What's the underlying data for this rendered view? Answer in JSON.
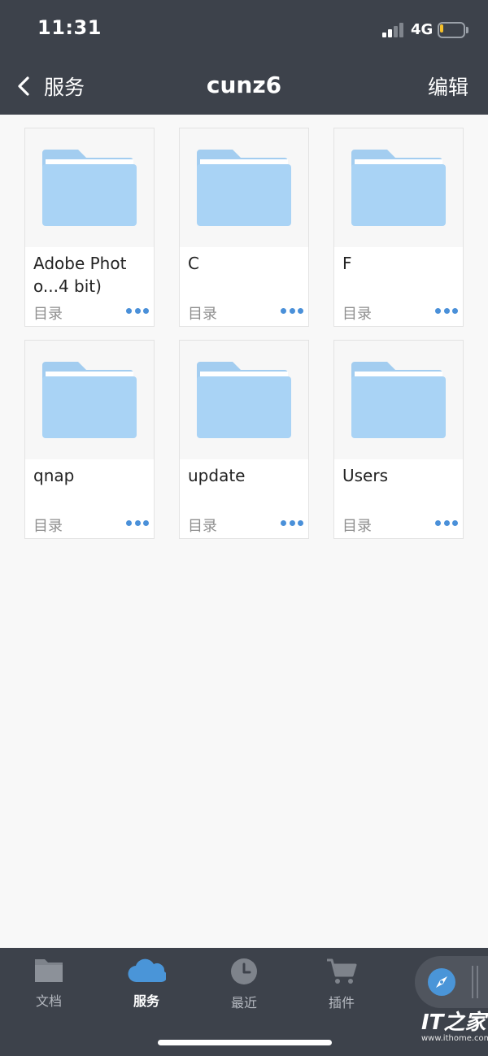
{
  "status_bar": {
    "time": "11:31",
    "network": "4G",
    "battery_level": 0.15,
    "battery_color": "#f5c02a"
  },
  "nav": {
    "back_label": "服务",
    "title": "cunz6",
    "edit_label": "编辑"
  },
  "folders": [
    {
      "name": "Adobe Photo...4 bit)",
      "kind": "目录"
    },
    {
      "name": "C",
      "kind": "目录"
    },
    {
      "name": "F",
      "kind": "目录"
    },
    {
      "name": "qnap",
      "kind": "目录"
    },
    {
      "name": "update",
      "kind": "目录"
    },
    {
      "name": "Users",
      "kind": "目录"
    }
  ],
  "tabs": [
    {
      "label": "文档",
      "icon": "folder-icon",
      "active": false
    },
    {
      "label": "服务",
      "icon": "cloud-icon",
      "active": true
    },
    {
      "label": "最近",
      "icon": "clock-icon",
      "active": false
    },
    {
      "label": "插件",
      "icon": "cart-icon",
      "active": false
    }
  ],
  "assist_icon": "compass-icon",
  "watermark": {
    "logo": "IT之家",
    "url": "www.ithome.com"
  },
  "colors": {
    "header_bg": "#3d424b",
    "folder_blue": "#a9d3f5",
    "accent_blue": "#4a90d9"
  }
}
